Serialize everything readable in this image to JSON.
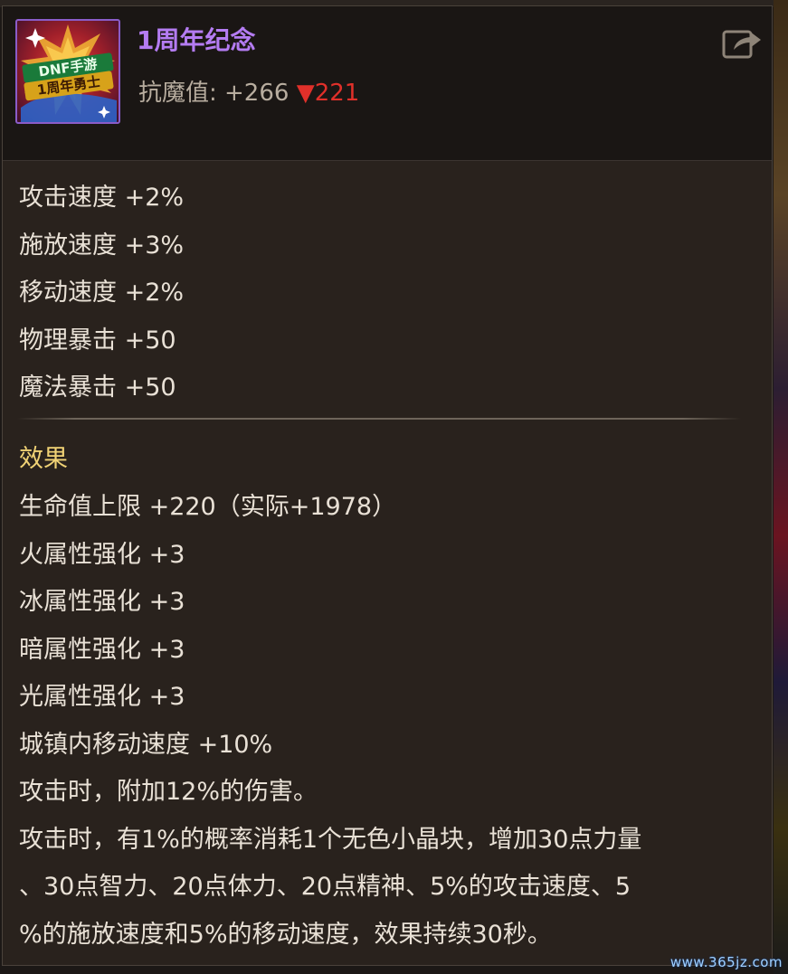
{
  "item": {
    "title": "1周年纪念",
    "icon": "dnf-anniversary-badge-icon",
    "icon_text_line1": "DNF手游",
    "icon_text_line2": "1周年勇士"
  },
  "resistance": {
    "label": "抗魔值: +266 ",
    "down_arrow": "▼",
    "down_value": "221",
    "down_color": "#e0302a"
  },
  "stats": [
    "攻击速度 +2%",
    "施放速度 +3%",
    "移动速度 +2%",
    "物理暴击 +50",
    "魔法暴击 +50"
  ],
  "effects": {
    "header": "效果",
    "lines": [
      "生命值上限 +220（实际+1978）",
      "火属性强化 +3",
      "冰属性强化 +3",
      "暗属性强化 +3",
      "光属性强化 +3",
      "城镇内移动速度 +10%",
      "攻击时，附加12%的伤害。",
      "攻击时，有1%的概率消耗1个无色小晶块，增加30点力量",
      "、30点智力、20点体力、20点精神、5%的攻击速度、5",
      "%的施放速度和5%的移动速度，效果持续30秒。"
    ]
  },
  "share_icon": "share-icon",
  "watermark": "www.365jz.com",
  "colors": {
    "title": "#b47cf2",
    "effects_header": "#f0d275",
    "text": "#e9e1d6",
    "secondary_text": "#b8ad9f",
    "panel_bg": "#29221d",
    "header_bg": "#1a1614",
    "icon_border": "#8a5cc8"
  }
}
